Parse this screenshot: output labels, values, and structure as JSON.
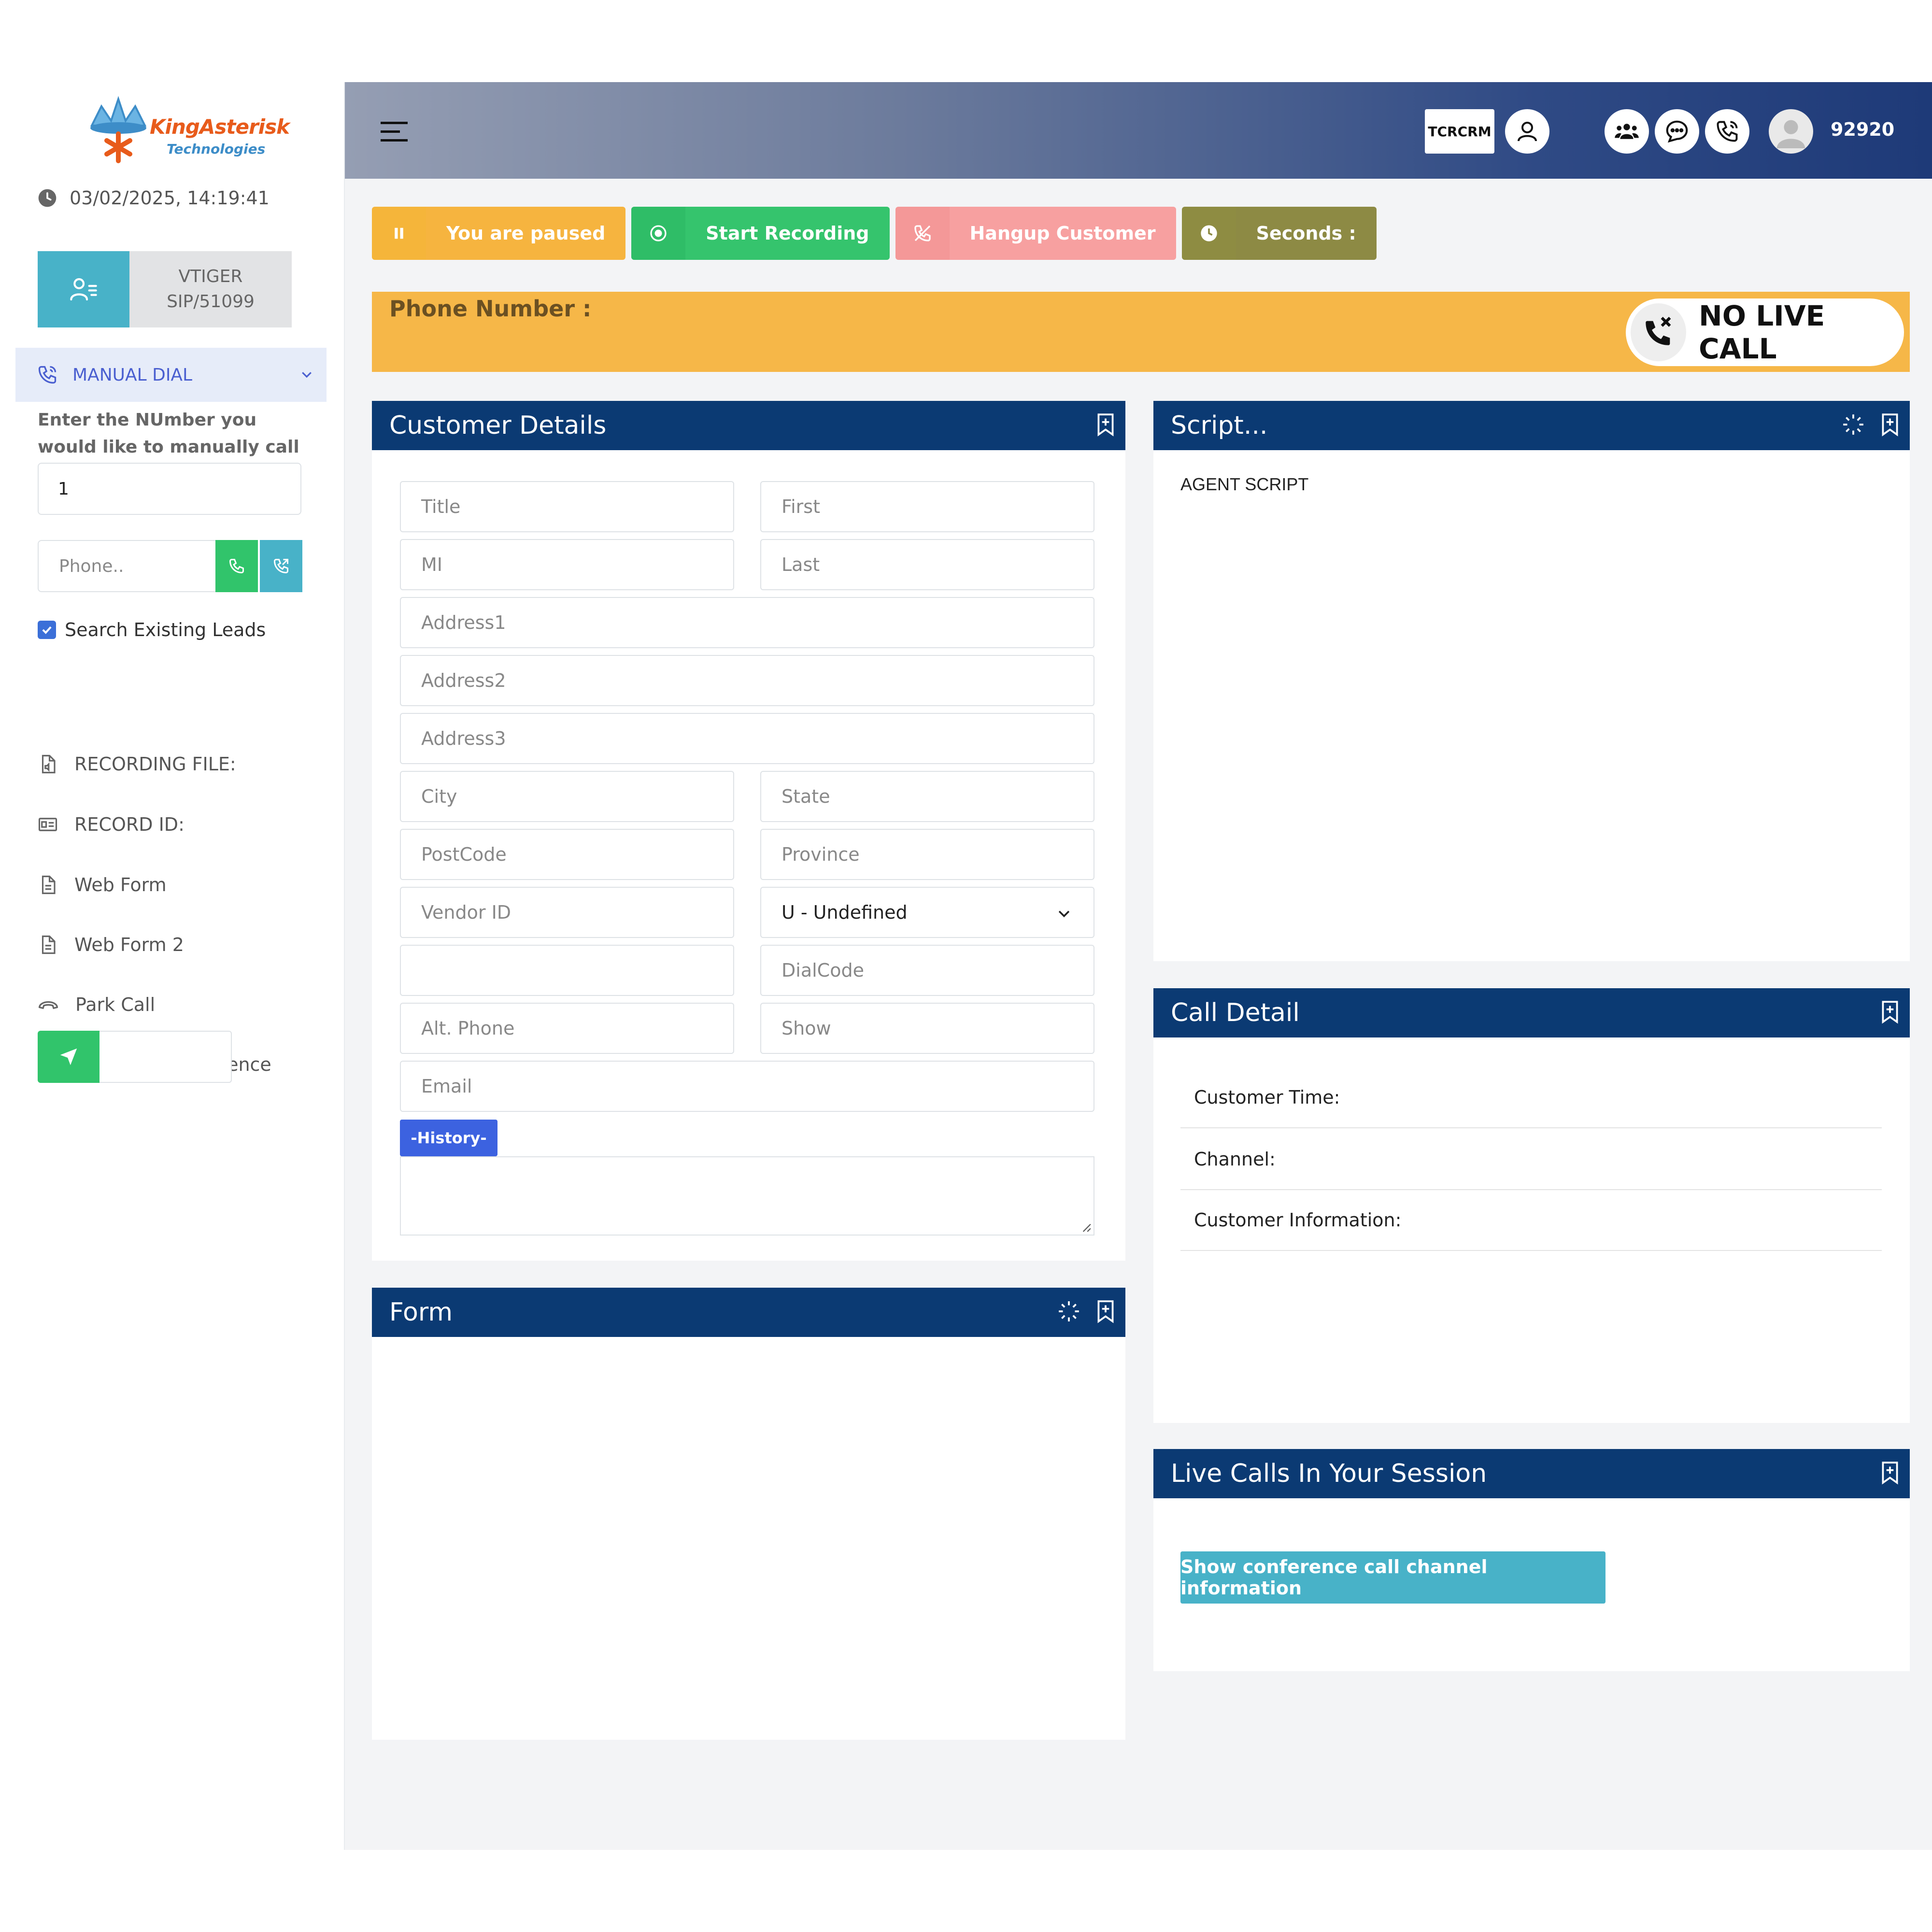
{
  "logo": {
    "brand": "KingAsterisk",
    "sub": "Technologies"
  },
  "sidebar": {
    "datetime": "03/02/2025, 14:19:41",
    "agent": {
      "line1": "VTIGER",
      "line2": "SIP/51099"
    },
    "manual_dial_label": "MANUAL DIAL",
    "dial_note": "Enter the NUmber you would like to manually call",
    "number_value": "1",
    "phone_placeholder": "Phone..",
    "search_leads_label": "Search Existing Leads",
    "items": [
      {
        "label": "RECORDING FILE:"
      },
      {
        "label": "RECORD ID:"
      },
      {
        "label": "Web Form"
      },
      {
        "label": "Web Form 2"
      },
      {
        "label": "Park Call"
      },
      {
        "label": "Transfer - Conference"
      }
    ]
  },
  "header": {
    "crm_label": "TCRCRM",
    "agent_number": "92920"
  },
  "actions": {
    "pause": "You are paused",
    "record": "Start Recording",
    "hangup": "Hangup Customer",
    "seconds": "Seconds :"
  },
  "phone_banner": {
    "label": "Phone Number :",
    "status": "NO LIVE CALL"
  },
  "customer_details": {
    "title": "Customer Details",
    "fields": {
      "title": "Title",
      "first": "First",
      "mi": "MI",
      "last": "Last",
      "address1": "Address1",
      "address2": "Address2",
      "address3": "Address3",
      "city": "City",
      "state": "State",
      "postcode": "PostCode",
      "province": "Province",
      "vendor_id": "Vendor ID",
      "gender_selected": "U - Undefined",
      "blank": "",
      "dialcode": "DialCode",
      "alt_phone": "Alt. Phone",
      "show": "Show",
      "email": "Email"
    },
    "history_label": "-History-"
  },
  "form_panel": {
    "title": "Form"
  },
  "script_panel": {
    "title": "Script...",
    "content": "AGENT SCRIPT"
  },
  "call_detail": {
    "title": "Call Detail",
    "rows": [
      "Customer Time:",
      "Channel:",
      "Customer Information:"
    ]
  },
  "live_calls": {
    "title": "Live Calls In Your Session",
    "button": "Show conference call channel information"
  },
  "colors": {
    "navy": "#0b3a73",
    "orange": "#f6b748",
    "green": "#35c46d",
    "pink": "#f7a0a0",
    "olive": "#8d8a44",
    "teal": "#48b2c8"
  }
}
